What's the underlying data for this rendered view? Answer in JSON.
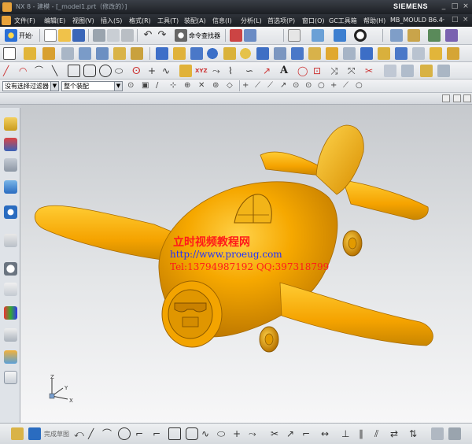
{
  "window": {
    "title": "NX 8 - 建模 - [_model1.prt（修改的）]",
    "brand": "SIEMENS",
    "controls": [
      "_",
      "□",
      "×"
    ]
  },
  "menubar": {
    "items": [
      "文件(F)",
      "编辑(E)",
      "视图(V)",
      "插入(S)",
      "格式(R)",
      "工具(T)",
      "装配(A)",
      "信息(I)",
      "分析(L)",
      "首选项(P)",
      "窗口(O)",
      "GC工具箱",
      "帮助(H)",
      "MB_MOULD B6.4"
    ],
    "right_controls": [
      "-",
      "□",
      "×"
    ]
  },
  "toolbar_standard": {
    "start_label": "开始·",
    "command_finder_label": "命令查找器"
  },
  "filter_bar": {
    "type_filter": "没有选择过滤器",
    "scope_filter": "整个装配"
  },
  "graphics": {
    "watermark_line1": "立时视频教程网",
    "watermark_line2": "http://www.proeug.com",
    "watermark_line3": "Tel:13794987192   QQ:397318799",
    "triad_labels": [
      "Z",
      "X",
      "Y"
    ]
  },
  "bottombar": {
    "sketch_label": "完成草图"
  },
  "colors": {
    "model": "#f6a800",
    "model_dark": "#c98600",
    "watermark_red": "#ff1a1a",
    "watermark_blue": "#2030ff"
  }
}
